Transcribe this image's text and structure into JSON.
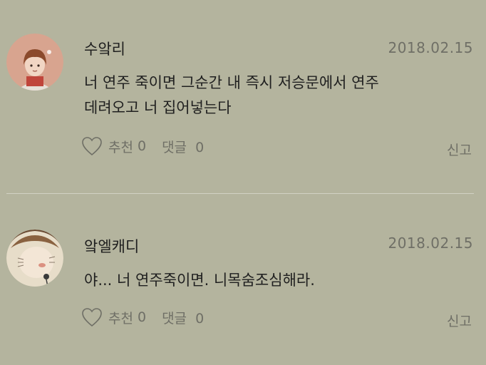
{
  "comments": [
    {
      "username": "수앜리",
      "date": "2018.02.15",
      "lines": [
        "너 연주 죽이면 그순간 내 즉시 저승문에서 연주",
        "데려오고 너 집어넣는다"
      ],
      "like_label": "추천",
      "like_count": "0",
      "reply_label": "댓글",
      "reply_count": "0",
      "report_label": "신고",
      "avatar_icon": "user-avatar-photo"
    },
    {
      "username": "앜엘캐디",
      "date": "2018.02.15",
      "lines": [
        "야... 너 연주죽이면. 니목숨조심해라."
      ],
      "like_label": "추천",
      "like_count": "0",
      "reply_label": "댓글",
      "reply_count": "0",
      "report_label": "신고",
      "avatar_icon": "user-avatar-photo"
    }
  ],
  "colors": {
    "background": "#b4b49e",
    "text": "#1f1f1f",
    "muted": "#6f6f66",
    "divider": "#d2d2c4"
  }
}
